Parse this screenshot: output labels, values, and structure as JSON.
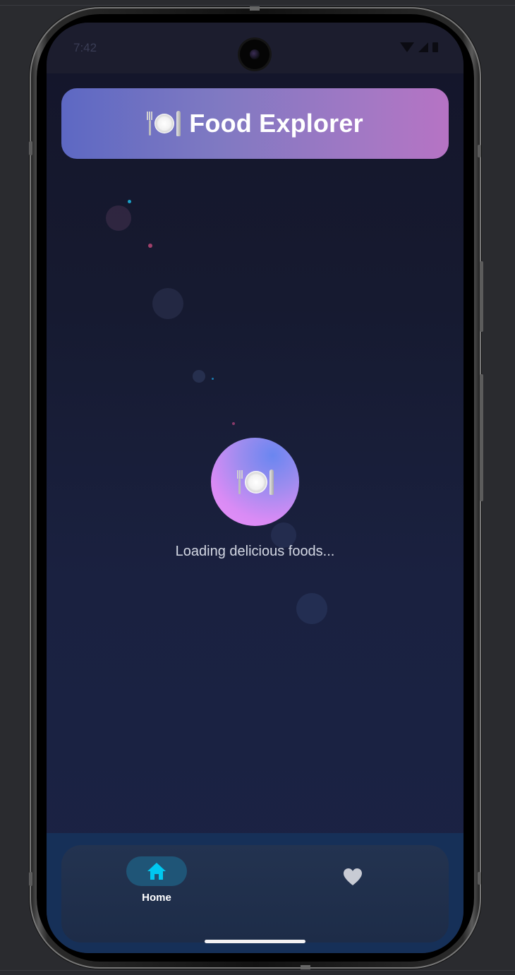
{
  "status_bar": {
    "time": "7:42"
  },
  "header": {
    "icon": "fork-knife-plate-icon",
    "title": "Food Explorer"
  },
  "loading": {
    "icon": "fork-knife-plate-icon",
    "text": "Loading delicious foods..."
  },
  "bottom_nav": {
    "items": [
      {
        "label": "Home",
        "icon": "home-icon",
        "selected": true
      },
      {
        "label": "",
        "icon": "heart-icon",
        "selected": false
      }
    ]
  },
  "colors": {
    "accent": "#00c8f0",
    "header_gradient_start": "#5d68c3",
    "header_gradient_end": "#b673c4",
    "loader_gradient_start": "#6a86f0",
    "loader_gradient_end": "#ea8ff7",
    "background": "#1a2140"
  }
}
